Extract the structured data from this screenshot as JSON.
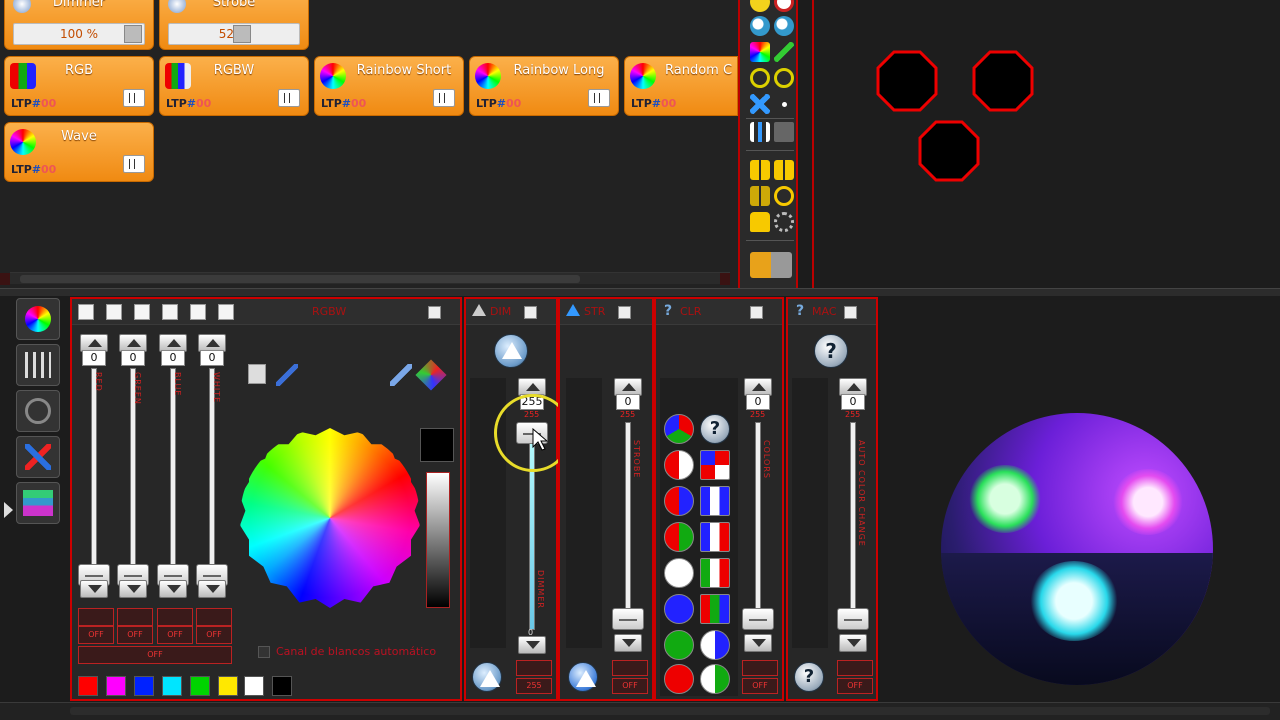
{
  "scenes": {
    "dimmer": {
      "label": "Dimmer",
      "value": "100 %"
    },
    "strobe": {
      "label": "Strobe",
      "value": "52 %"
    },
    "buttons": [
      {
        "label": "RGB",
        "icon": "rgb-bars-icon"
      },
      {
        "label": "RGBW",
        "icon": "rgbw-bars-icon"
      },
      {
        "label": "Rainbow Short",
        "icon": "rainbow-ball-icon"
      },
      {
        "label": "Rainbow Long",
        "icon": "rainbow-ball-icon"
      },
      {
        "label": "Random C",
        "icon": "rainbow-ball-icon"
      },
      {
        "label": "Wave",
        "icon": "rainbow-ball-icon"
      }
    ],
    "mini_prefix": "LTP",
    "mini_hash": "#",
    "mini_count": "00"
  },
  "rgb_panel": {
    "title": "RGBW",
    "fader_values": [
      "0",
      "0",
      "0",
      "0"
    ],
    "channel_labels": [
      "RED",
      "GREEN",
      "BLUE",
      "WHITE"
    ],
    "bottom_labels": [
      "OFF",
      "OFF",
      "OFF",
      "OFF"
    ],
    "all_off": "OFF",
    "auto_white_label": "Canal de blancos automático",
    "swatches": [
      "#ff0000",
      "#ff00ff",
      "#0022ff",
      "#00e5ff",
      "#00d400",
      "#ffe800",
      "#ffffff",
      "#000000"
    ]
  },
  "dimmer_panel": {
    "title": "DIM",
    "top_value": "255",
    "max_label": "255",
    "min_label": "0",
    "channel_label": "DIMMER",
    "bottom_label": "255"
  },
  "strobe_panel": {
    "title": "STR",
    "top_value": "0",
    "max_label": "255",
    "channel_label": "STROBE",
    "bottom_label": "OFF"
  },
  "color_panel": {
    "title": "CLR",
    "top_value": "0",
    "max_label": "255",
    "channel_label": "COLORS",
    "bottom_label": "OFF"
  },
  "macro_panel": {
    "title": "MAC",
    "top_value": "0",
    "max_label": "255",
    "channel_label": "AUTO COLOR CHANGE",
    "bottom_label": "OFF"
  },
  "colors": {
    "accent_red": "#cc0000",
    "scene_orange": "#f59a2a",
    "bg_dark": "#1c1c1c"
  }
}
